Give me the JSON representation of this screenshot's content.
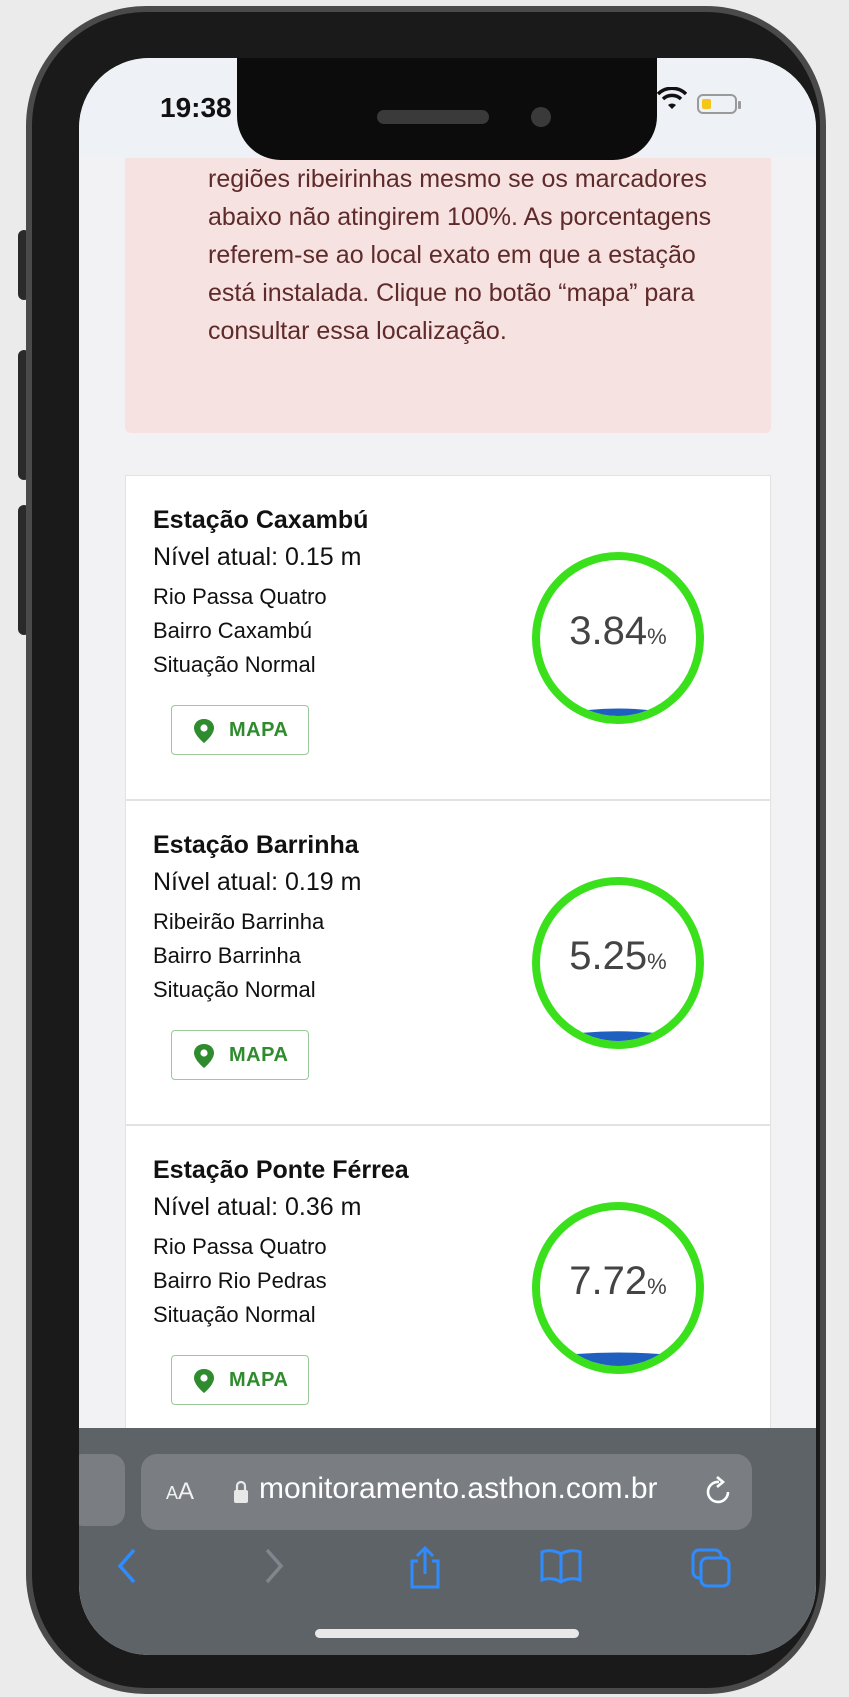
{
  "status_bar": {
    "time": "19:38",
    "battery_color": "#f5c518"
  },
  "alert": {
    "text": "regiões ribeirinhas mesmo se os marcadores abaixo não atingirem 100%. As porcentagens referem-se ao local exato em que a estação está instalada. Clique no botão “mapa” para consultar essa localização."
  },
  "stations": [
    {
      "name": "Estação Caxambú",
      "level": "Nível atual: 0.15 m",
      "river": "Rio Passa Quatro",
      "neighborhood": "Bairro Caxambú",
      "situation": "Situação Normal",
      "map_label": "MAPA",
      "percent_text": "3.84",
      "percent_unit": "%",
      "percent": 3.84
    },
    {
      "name": "Estação Barrinha",
      "level": "Nível atual: 0.19 m",
      "river": "Ribeirão Barrinha",
      "neighborhood": "Bairro Barrinha",
      "situation": "Situação Normal",
      "map_label": "MAPA",
      "percent_text": "5.25",
      "percent_unit": "%",
      "percent": 5.25
    },
    {
      "name": "Estação Ponte Férrea",
      "level": "Nível atual: 0.36 m",
      "river": "Rio Passa Quatro",
      "neighborhood": "Bairro Rio Pedras",
      "situation": "Situação Normal",
      "map_label": "MAPA",
      "percent_text": "7.72",
      "percent_unit": "%",
      "percent": 7.72
    }
  ],
  "browser": {
    "aa_label_small": "A",
    "aa_label_large": "A",
    "url": "monitoramento.asthon.com.br"
  },
  "colors": {
    "gauge_ring": "#3be01c",
    "water": "#1f5fbf",
    "map_green": "#2e8b2e",
    "alert_bg": "#f7e2e2",
    "ios_blue": "#2f8cff"
  }
}
